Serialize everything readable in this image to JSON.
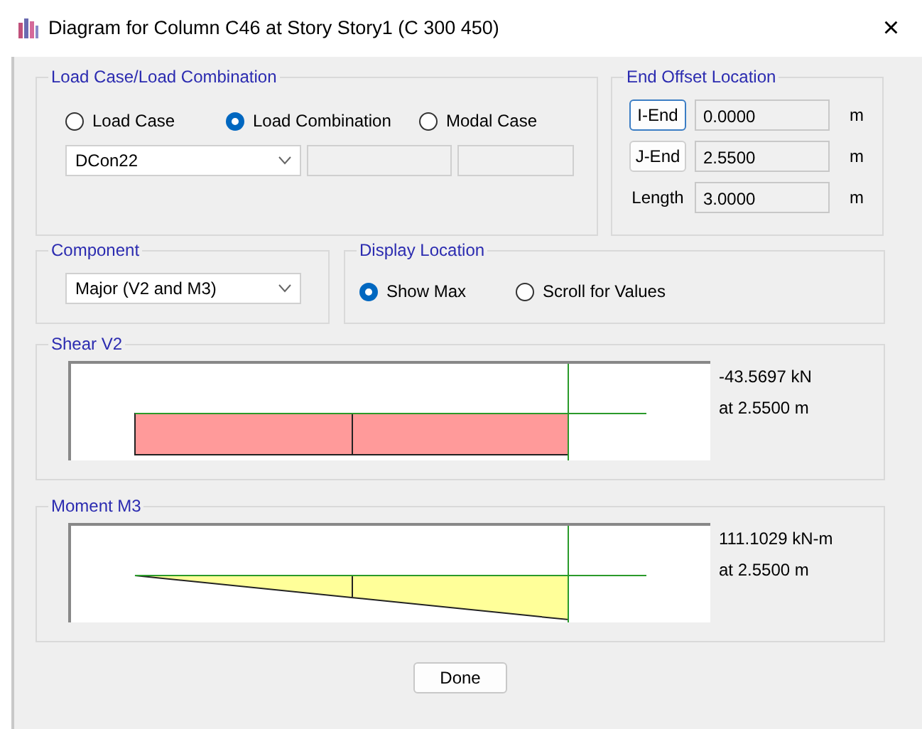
{
  "window": {
    "title": "Diagram for Column C46 at Story Story1 (C 300 450)",
    "close": "×"
  },
  "load_case": {
    "title": "Load Case/Load Combination",
    "options": [
      {
        "label": "Load Case",
        "selected": false
      },
      {
        "label": "Load Combination",
        "selected": true
      },
      {
        "label": "Modal Case",
        "selected": false
      }
    ],
    "value": "DCon22"
  },
  "end_offset": {
    "title": "End Offset Location",
    "rows": [
      {
        "kind": "button",
        "label": "I-End",
        "focused": true,
        "value": "0.0000",
        "unit": "m"
      },
      {
        "kind": "button",
        "label": "J-End",
        "focused": false,
        "value": "2.5500",
        "unit": "m"
      },
      {
        "kind": "label",
        "label": "Length",
        "value": "3.0000",
        "unit": "m"
      }
    ]
  },
  "component": {
    "title": "Component",
    "value": "Major (V2 and M3)"
  },
  "display_location": {
    "title": "Display Location",
    "options": [
      {
        "label": "Show Max",
        "selected": true
      },
      {
        "label": "Scroll for Values",
        "selected": false
      }
    ]
  },
  "diagrams": [
    {
      "kind": "shear",
      "title": "Shear V2",
      "value": "-43.5697 kN",
      "location": "at 2.5500 m"
    },
    {
      "kind": "moment",
      "title": "Moment M3",
      "value": "111.1029 kN-m",
      "location": "at 2.5500 m"
    }
  ],
  "buttons": [
    "Done"
  ]
}
